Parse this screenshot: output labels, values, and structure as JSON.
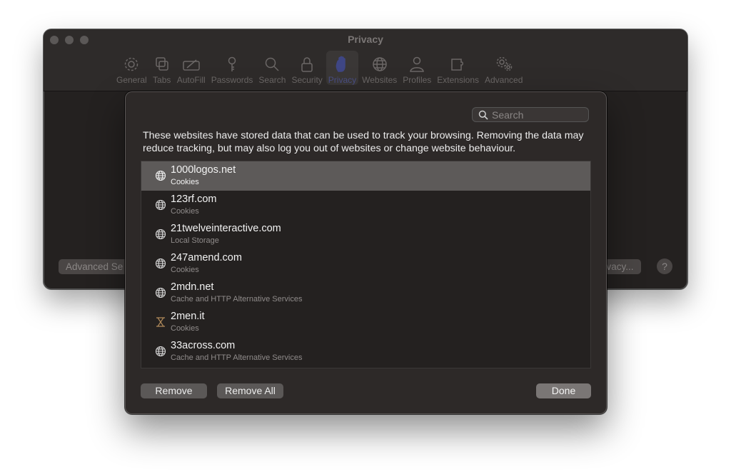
{
  "window": {
    "title": "Privacy",
    "toolbar_tabs": [
      {
        "label": "General",
        "icon": "gear-icon"
      },
      {
        "label": "Tabs",
        "icon": "tabs-icon"
      },
      {
        "label": "AutoFill",
        "icon": "autofill-icon"
      },
      {
        "label": "Passwords",
        "icon": "key-icon"
      },
      {
        "label": "Search",
        "icon": "search-icon"
      },
      {
        "label": "Security",
        "icon": "lock-icon"
      },
      {
        "label": "Privacy",
        "icon": "hand-icon"
      },
      {
        "label": "Websites",
        "icon": "globe-icon"
      },
      {
        "label": "Profiles",
        "icon": "person-icon"
      },
      {
        "label": "Extensions",
        "icon": "puzzle-icon"
      },
      {
        "label": "Advanced",
        "icon": "gears-icon"
      }
    ],
    "active_tab": "Privacy",
    "advanced_button_label": "Advanced Se",
    "privacy_button_label": "rivacy...",
    "help_label": "?"
  },
  "sheet": {
    "search": {
      "placeholder": "Search",
      "value": ""
    },
    "description": "These websites have stored data that can be used to track your browsing. Removing the data may reduce tracking, but may also log you out of websites or change website behaviour.",
    "sites": [
      {
        "name": "1000logos.net",
        "kind": "Cookies",
        "icon": "globe-icon"
      },
      {
        "name": "123rf.com",
        "kind": "Cookies",
        "icon": "globe-icon"
      },
      {
        "name": "21twelveinteractive.com",
        "kind": "Local Storage",
        "icon": "globe-icon"
      },
      {
        "name": "247amend.com",
        "kind": "Cookies",
        "icon": "globe-icon"
      },
      {
        "name": "2mdn.net",
        "kind": "Cache and HTTP Alternative Services",
        "icon": "globe-icon"
      },
      {
        "name": "2men.it",
        "kind": "Cookies",
        "icon": "site-favicon-icon"
      },
      {
        "name": "33across.com",
        "kind": "Cache and HTTP Alternative Services",
        "icon": "globe-icon"
      }
    ],
    "selected_site": "1000logos.net",
    "buttons": {
      "remove": "Remove",
      "remove_all": "Remove All",
      "done": "Done"
    }
  },
  "colors": {
    "window_bg": "#242120",
    "sheet_bg": "#2d2928",
    "selection_bg": "#5d5a59",
    "active_tab_accent": "#3f4684"
  }
}
